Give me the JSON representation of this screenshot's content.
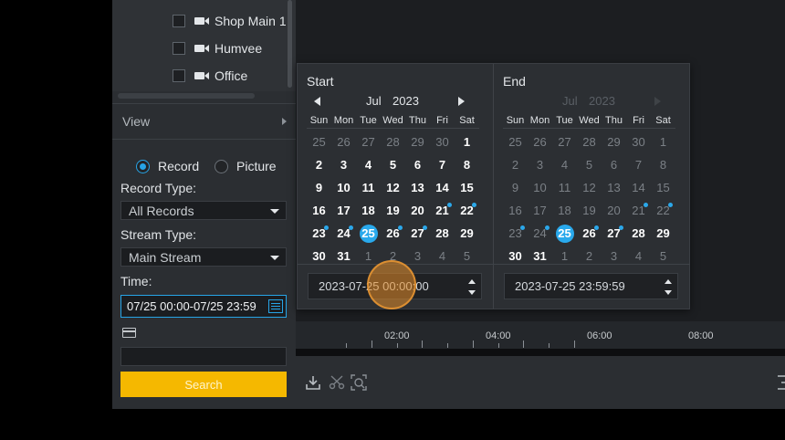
{
  "camera_list": {
    "items": [
      {
        "label": "Shop Main 1"
      },
      {
        "label": "Humvee"
      },
      {
        "label": "Office"
      }
    ]
  },
  "view": {
    "label": "View"
  },
  "record_mode": {
    "record": "Record",
    "picture": "Picture",
    "selected": "Record"
  },
  "record_type": {
    "label": "Record Type:",
    "value": "All Records"
  },
  "stream_type": {
    "label": "Stream Type:",
    "value": "Main Stream"
  },
  "time": {
    "label": "Time:",
    "value": "07/25 00:00-07/25 23:59"
  },
  "search": {
    "label": "Search"
  },
  "timeline": {
    "labels": [
      "02:00",
      "04:00",
      "06:00",
      "08:00"
    ]
  },
  "date_picker": {
    "weekdays": [
      "Sun",
      "Mon",
      "Tue",
      "Wed",
      "Thu",
      "Fri",
      "Sat"
    ],
    "start": {
      "title": "Start",
      "month": "Jul",
      "year": "2023",
      "time_value": "2023-07-25 00:00:00",
      "days": [
        "25",
        "26",
        "27",
        "28",
        "29",
        "30",
        "1",
        "2",
        "3",
        "4",
        "5",
        "6",
        "7",
        "8",
        "9",
        "10",
        "11",
        "12",
        "13",
        "14",
        "15",
        "16",
        "17",
        "18",
        "19",
        "20",
        "21",
        "22",
        "23",
        "24",
        "25",
        "26",
        "27",
        "28",
        "29",
        "30",
        "31",
        "1",
        "2",
        "3",
        "4",
        "5"
      ]
    },
    "end": {
      "title": "End",
      "month": "Jul",
      "year": "2023",
      "time_value": "2023-07-25 23:59:59",
      "days": [
        "25",
        "26",
        "27",
        "28",
        "29",
        "30",
        "1",
        "2",
        "3",
        "4",
        "5",
        "6",
        "7",
        "8",
        "9",
        "10",
        "11",
        "12",
        "13",
        "14",
        "15",
        "16",
        "17",
        "18",
        "19",
        "20",
        "21",
        "22",
        "23",
        "24",
        "25",
        "26",
        "27",
        "28",
        "29",
        "30",
        "31",
        "1",
        "2",
        "3",
        "4",
        "5"
      ]
    },
    "recorded_days": [
      "21",
      "22",
      "23",
      "24",
      "26",
      "27"
    ],
    "selected_day": "25"
  },
  "colors": {
    "accent": "#27a4e6",
    "search_button": "#f5b800",
    "click_indicator": "#e48c28"
  }
}
